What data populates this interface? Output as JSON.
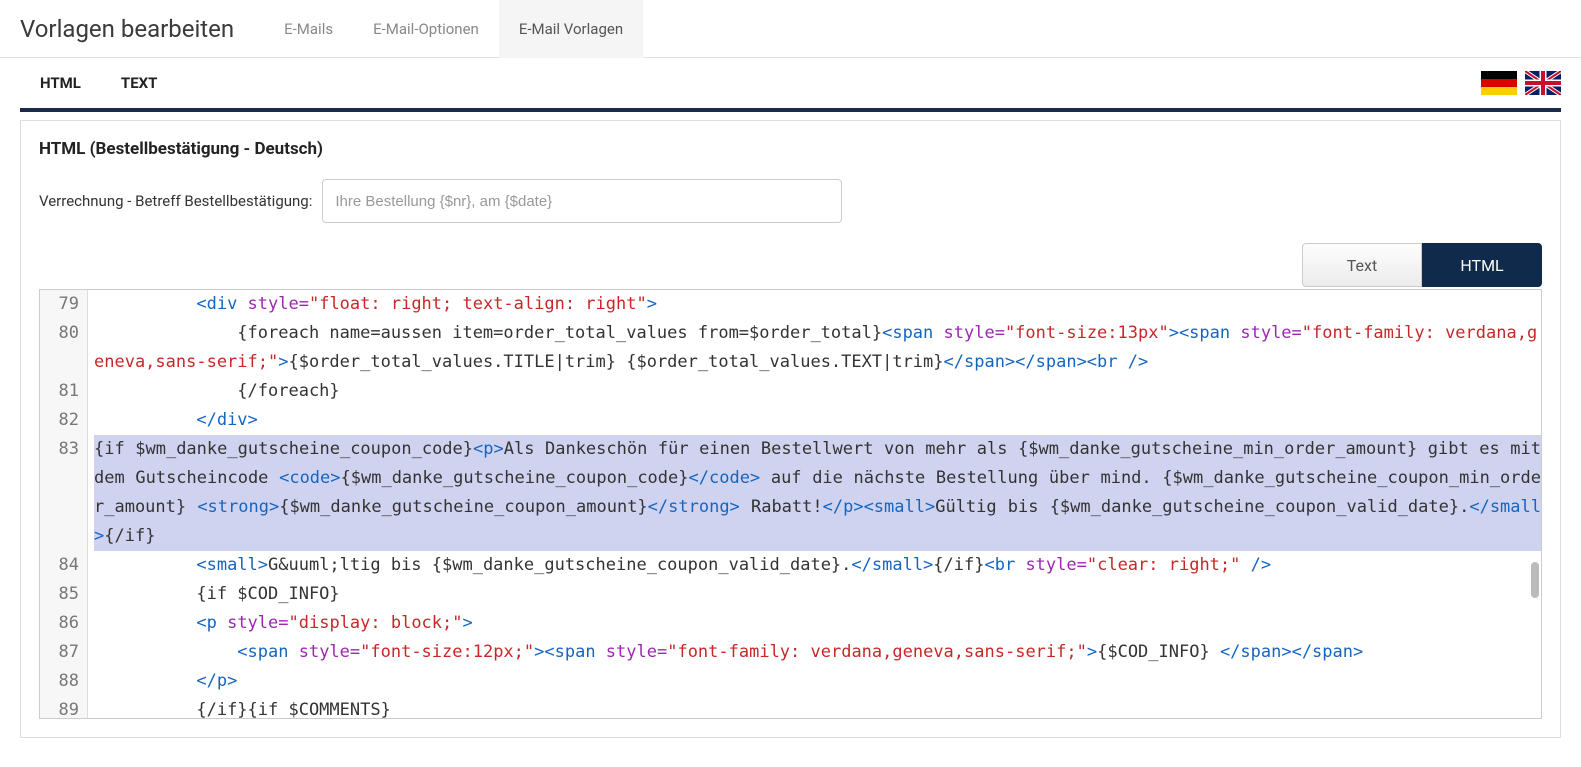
{
  "topnav": {
    "title": "Vorlagen bearbeiten",
    "items": [
      "E-Mails",
      "E-Mail-Optionen",
      "E-Mail Vorlagen"
    ],
    "activeIndex": 2
  },
  "subtabs": {
    "items": [
      "HTML",
      "TEXT"
    ]
  },
  "panel": {
    "title": "HTML (Bestellbestätigung - Deutsch)",
    "fieldLabel": "Verrechnung - Betreff Bestellbestätigung:",
    "fieldPlaceholder": "Ihre Bestellung {$nr}, am {$date}"
  },
  "editorTabs": {
    "text": "Text",
    "html": "HTML"
  },
  "code": {
    "lineNumbers": [
      "79",
      "80",
      "",
      "81",
      "82",
      "83",
      "",
      "",
      "",
      "84",
      "85",
      "86",
      "87",
      "88",
      "89"
    ],
    "line79": {
      "indent": "          ",
      "t1": "<div ",
      "a1": "style=",
      "s1": "\"float: right; text-align: right\"",
      "t2": ">"
    },
    "line80": {
      "indent": "              ",
      "sm1": "{foreach name=aussen item=order_total_values from=$order_total}",
      "t1": "<span ",
      "a1": "style=",
      "s1": "\"font-size:13px\"",
      "t2": "><span ",
      "a2": "style=",
      "s2": "\"font-family: verdana,geneva,sans-serif;\"",
      "t3": ">",
      "sm2": "{$order_total_values.TITLE|trim} {$order_total_values.TEXT|trim}",
      "t4": "</span></span><br />"
    },
    "line81": {
      "indent": "              ",
      "sm1": "{/foreach}"
    },
    "line82": {
      "indent": "          ",
      "t1": "</div>"
    },
    "line83": {
      "sm1": "{if $wm_danke_gutscheine_coupon_code}",
      "t1": "<p>",
      "x1": "Als Dankeschön für einen Bestellwert von mehr als {$wm_danke_gutscheine_min_order_amount} gibt es mit dem Gutscheincode ",
      "t2": "<code>",
      "x2": "{$wm_danke_gutscheine_coupon_code}",
      "t3": "</code>",
      "x3": " auf die nächste Bestellung über mind. {$wm_danke_gutscheine_coupon_min_order_amount} ",
      "t4": "<strong>",
      "x4": "{$wm_danke_gutscheine_coupon_amount}",
      "t5": "</strong>",
      "x5": " Rabatt!",
      "t6": "</p><small>",
      "x6": "Gültig bis {$wm_danke_gutscheine_coupon_valid_date}.",
      "t7": "</small>",
      "sm2": "{/if}"
    },
    "line84": {
      "indent": "          ",
      "t1": "<small>",
      "x1": "G&uuml;ltig bis {$wm_danke_gutscheine_coupon_valid_date}.",
      "t2": "</small>",
      "sm1": "{/if}",
      "t3": "<br ",
      "a1": "style=",
      "s1": "\"clear: right;\"",
      "t4": " />"
    },
    "line85": {
      "indent": "          ",
      "sm1": "{if $COD_INFO}"
    },
    "line86": {
      "indent": "          ",
      "t1": "<p ",
      "a1": "style=",
      "s1": "\"display: block;\"",
      "t2": ">"
    },
    "line87": {
      "indent": "              ",
      "t1": "<span ",
      "a1": "style=",
      "s1": "\"font-size:12px;\"",
      "t2": "><span ",
      "a2": "style=",
      "s2": "\"font-family: verdana,geneva,sans-serif;\"",
      "t3": ">",
      "x1": "{$COD_INFO} ",
      "t4": "</span></span>"
    },
    "line88": {
      "indent": "          ",
      "t1": "</p>"
    },
    "line89": {
      "indent": "          ",
      "sm1": "{/if}{if $COMMENTS}"
    }
  }
}
